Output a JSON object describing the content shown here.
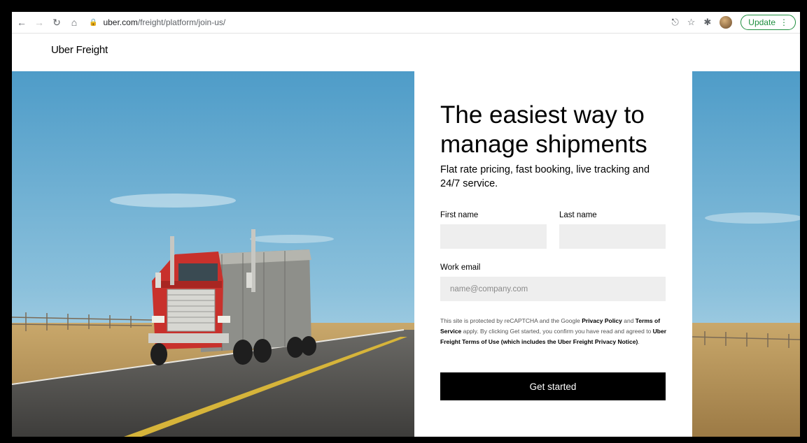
{
  "browser": {
    "url_host": "uber.com",
    "url_path": "/freight/platform/join-us/",
    "update_label": "Update"
  },
  "header": {
    "logo": "Uber Freight"
  },
  "form": {
    "headline": "The easiest way to manage shipments",
    "subheadline": "Flat rate pricing, fast booking, live tracking and 24/7 service.",
    "first_name_label": "First name",
    "last_name_label": "Last name",
    "first_name_value": "",
    "last_name_value": "",
    "email_label": "Work email",
    "email_placeholder": "name@company.com",
    "legal": {
      "part1": "This site is protected by reCAPTCHA and the Google ",
      "privacy_policy": "Privacy Policy",
      "part2": " and ",
      "terms_of_service": "Terms of Service",
      "part3": " apply. By clicking Get started, you confirm you have read and agreed to ",
      "terms_of_use": "Uber Freight Terms of Use (which includes the Uber Freight Privacy Notice)",
      "part4": "."
    },
    "submit_label": "Get started"
  },
  "colors": {
    "sky_top": "#5aa3cc",
    "sky_bottom": "#bcdbe8",
    "truck_red": "#c8312c",
    "button_bg": "#000000",
    "input_bg": "#eeeeee",
    "update_green": "#1e8e3e"
  },
  "icons": [
    "back-icon",
    "forward-icon",
    "reload-icon",
    "home-icon",
    "lock-icon",
    "share-icon",
    "star-icon",
    "extensions-icon",
    "avatar",
    "more-icon"
  ]
}
